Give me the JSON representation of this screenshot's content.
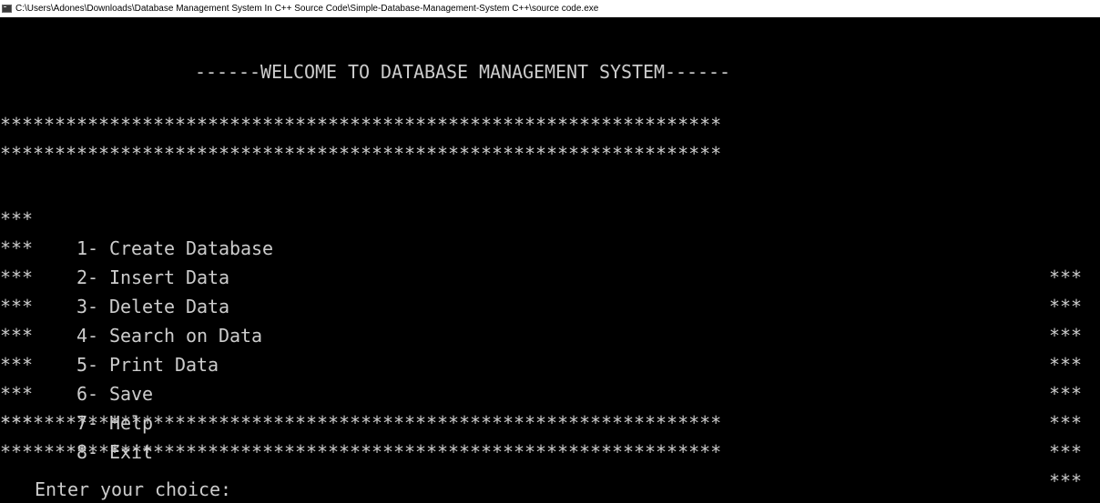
{
  "window": {
    "title": "C:\\Users\\Adones\\Downloads\\Database Management System In C++ Source Code\\Simple-Database-Management-System C++\\source code.exe"
  },
  "console": {
    "welcome": "------WELCOME TO DATABASE MANAGEMENT SYSTEM------",
    "stars_line": "******************************************************************",
    "row_border": "***",
    "menu": [
      {
        "label": "1- Create Database"
      },
      {
        "label": "2- Insert Data"
      },
      {
        "label": "3- Delete Data"
      },
      {
        "label": "4- Search on Data"
      },
      {
        "label": "5- Print Data"
      },
      {
        "label": "6- Save"
      },
      {
        "label": "7- Help"
      },
      {
        "label": "8- Exit"
      }
    ],
    "prompt": "Enter your choice:"
  }
}
